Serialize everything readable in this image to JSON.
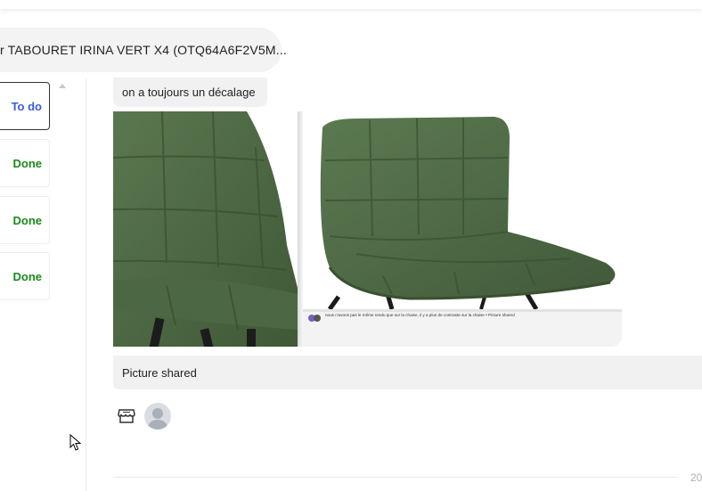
{
  "header": {
    "title": "r TABOURET IRINA VERT X4 (OTQ64A6F2V5M..."
  },
  "tasks": [
    {
      "status": "To do"
    },
    {
      "status": "Done"
    },
    {
      "status": "Done"
    },
    {
      "status": "Done"
    }
  ],
  "messages": {
    "text_message": "on a toujours un décalage",
    "shared_screenshot_caption": "nous n'avons pas le même rendu que sur la chaise, il y a plus de contraste sur la chaise • Picture shared",
    "picture_shared": "Picture shared"
  },
  "footer": {
    "date_fragment": "20"
  },
  "icons": {
    "store": "store-icon",
    "avatar": "user-avatar-placeholder",
    "scroll_up": "triangle-up-icon",
    "cursor": "mouse-pointer"
  },
  "colors": {
    "todo": "#3b5bdb",
    "done": "#1a8a1a",
    "chair_green": "#4f6b43"
  }
}
